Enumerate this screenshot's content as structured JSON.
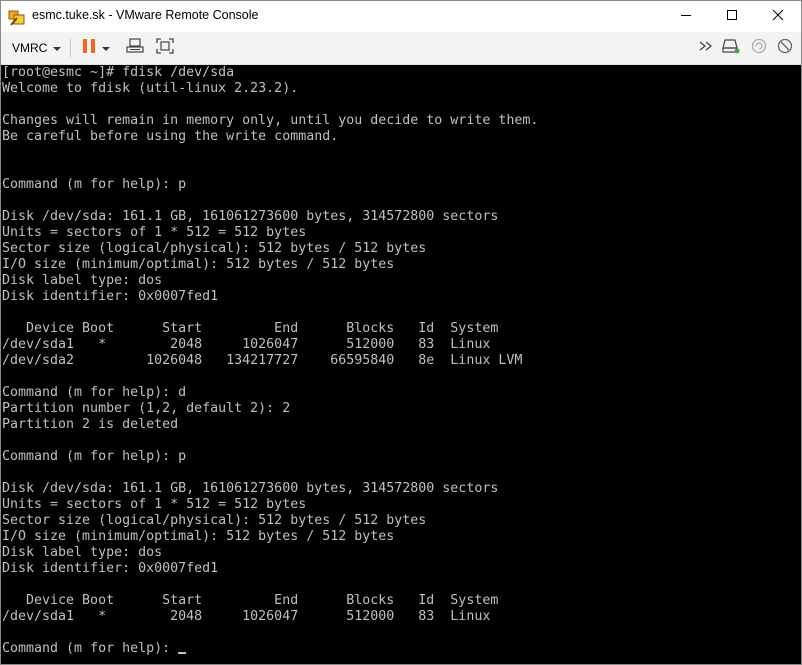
{
  "window": {
    "title": "esmc.tuke.sk - VMware Remote Console",
    "icons": {
      "app": "vmware-remote-console-icon",
      "minimize": "minimize-icon",
      "maximize": "maximize-icon",
      "close": "close-icon"
    }
  },
  "toolbar": {
    "menu_label": "VMRC",
    "icons": [
      "pause-icon",
      "send-ctrl-alt-del-icon",
      "fit-guest-icon",
      "fullscreen-icon",
      "forward-icon",
      "removable-devices-icon",
      "snapshot-icon",
      "help-icon"
    ]
  },
  "terminal": {
    "fg_color": "#c0c0c0",
    "bg_color": "#000000",
    "lines": [
      "[root@esmc ~]# fdisk /dev/sda",
      "Welcome to fdisk (util-linux 2.23.2).",
      "",
      "Changes will remain in memory only, until you decide to write them.",
      "Be careful before using the write command.",
      "",
      "",
      "Command (m for help): p",
      "",
      "Disk /dev/sda: 161.1 GB, 161061273600 bytes, 314572800 sectors",
      "Units = sectors of 1 * 512 = 512 bytes",
      "Sector size (logical/physical): 512 bytes / 512 bytes",
      "I/O size (minimum/optimal): 512 bytes / 512 bytes",
      "Disk label type: dos",
      "Disk identifier: 0x0007fed1",
      "",
      "   Device Boot      Start         End      Blocks   Id  System",
      "/dev/sda1   *        2048     1026047      512000   83  Linux",
      "/dev/sda2         1026048   134217727    66595840   8e  Linux LVM",
      "",
      "Command (m for help): d",
      "Partition number (1,2, default 2): 2",
      "Partition 2 is deleted",
      "",
      "Command (m for help): p",
      "",
      "Disk /dev/sda: 161.1 GB, 161061273600 bytes, 314572800 sectors",
      "Units = sectors of 1 * 512 = 512 bytes",
      "Sector size (logical/physical): 512 bytes / 512 bytes",
      "I/O size (minimum/optimal): 512 bytes / 512 bytes",
      "Disk label type: dos",
      "Disk identifier: 0x0007fed1",
      "",
      "   Device Boot      Start         End      Blocks   Id  System",
      "/dev/sda1   *        2048     1026047      512000   83  Linux",
      "",
      "Command (m for help): "
    ]
  }
}
